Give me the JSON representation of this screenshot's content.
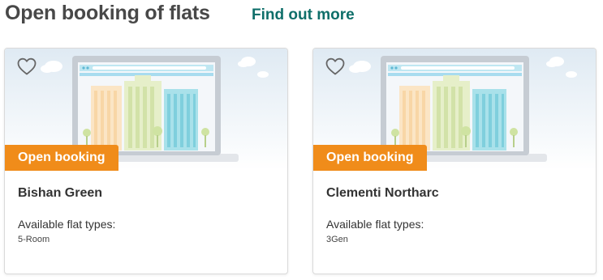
{
  "header": {
    "title": "Open booking of flats",
    "link_label": "Find out more"
  },
  "cards": [
    {
      "badge": "Open booking",
      "name": "Bishan Green",
      "flat_types_label": "Available flat types:",
      "flat_types": "5-Room",
      "favourite_icon": "heart-outline-icon"
    },
    {
      "badge": "Open booking",
      "name": "Clementi Northarc",
      "flat_types_label": "Available flat types:",
      "flat_types": "3Gen",
      "favourite_icon": "heart-outline-icon"
    }
  ],
  "colors": {
    "badge": "#f08c1a",
    "link": "#0f6f6a",
    "title": "#484848"
  }
}
